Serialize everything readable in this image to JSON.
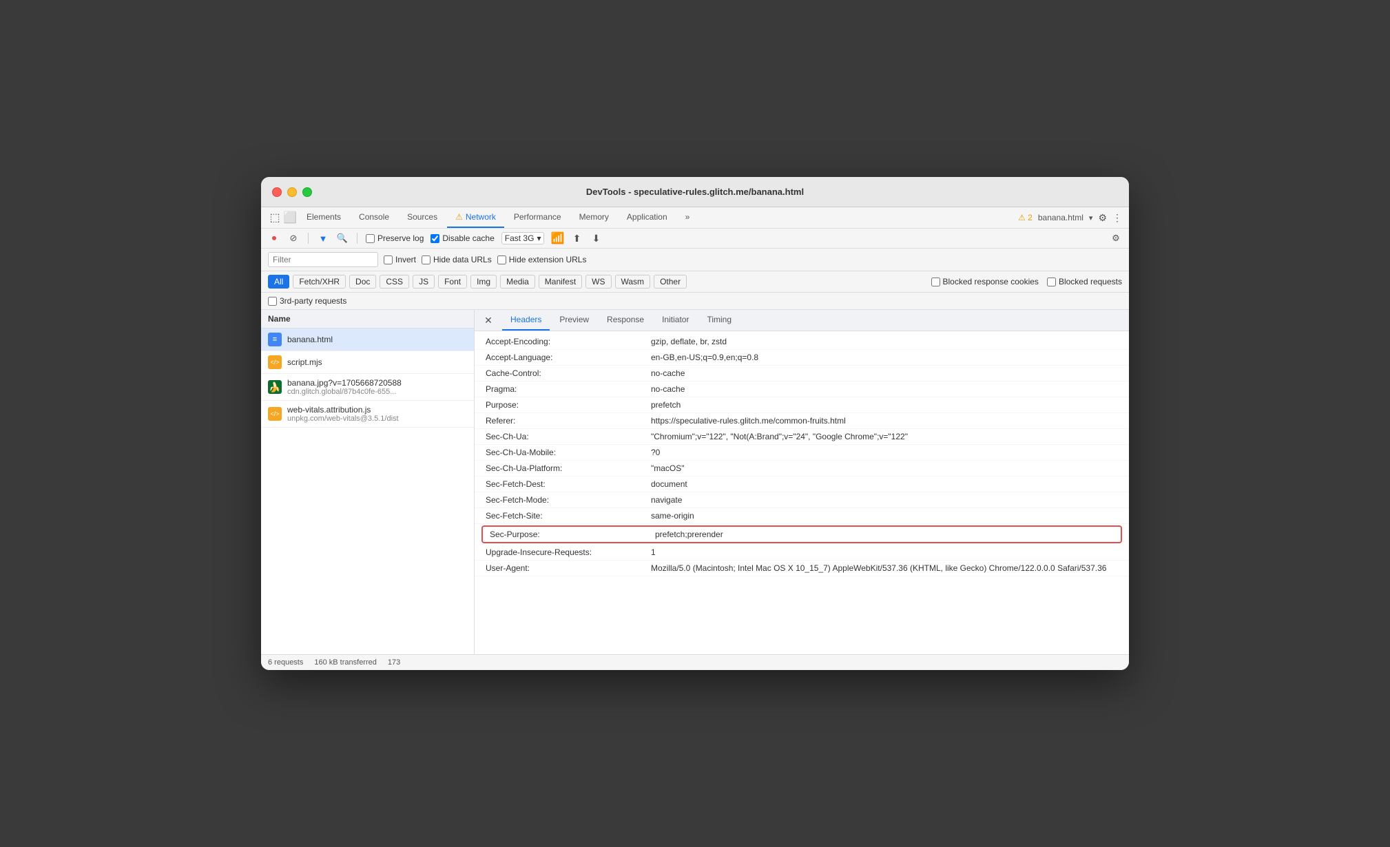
{
  "window": {
    "title": "DevTools - speculative-rules.glitch.me/banana.html"
  },
  "tabs": [
    {
      "label": "Elements",
      "active": false
    },
    {
      "label": "Console",
      "active": false
    },
    {
      "label": "Sources",
      "active": false
    },
    {
      "label": "⚠ Network",
      "active": true
    },
    {
      "label": "Performance",
      "active": false
    },
    {
      "label": "Memory",
      "active": false
    },
    {
      "label": "Application",
      "active": false
    },
    {
      "label": "»",
      "active": false
    }
  ],
  "tab_right": {
    "warning": "⚠ 2",
    "page": "banana.html",
    "settings": "⚙",
    "more": "⋮"
  },
  "controls": {
    "stop": "●",
    "clear": "⊘",
    "filter": "▼",
    "search": "🔍",
    "preserve_log": "Preserve log",
    "disable_cache": "Disable cache",
    "throttle": "Fast 3G",
    "wifi": "📶",
    "upload": "⬆",
    "download": "⬇",
    "settings": "⚙"
  },
  "filter": {
    "placeholder": "Filter",
    "invert": "Invert",
    "hide_data_urls": "Hide data URLs",
    "hide_extension_urls": "Hide extension URLs"
  },
  "type_buttons": [
    {
      "label": "All",
      "active": true
    },
    {
      "label": "Fetch/XHR",
      "active": false
    },
    {
      "label": "Doc",
      "active": false
    },
    {
      "label": "CSS",
      "active": false
    },
    {
      "label": "JS",
      "active": false
    },
    {
      "label": "Font",
      "active": false
    },
    {
      "label": "Img",
      "active": false
    },
    {
      "label": "Media",
      "active": false
    },
    {
      "label": "Manifest",
      "active": false
    },
    {
      "label": "WS",
      "active": false
    },
    {
      "label": "Wasm",
      "active": false
    },
    {
      "label": "Other",
      "active": false
    }
  ],
  "type_bar_right": {
    "blocked_cookies": "Blocked response cookies",
    "blocked_requests": "Blocked requests"
  },
  "third_party": "3rd-party requests",
  "left_panel": {
    "header": "Name",
    "requests": [
      {
        "name": "banana.html",
        "sub": "",
        "icon_type": "html",
        "icon_text": "≡",
        "selected": true
      },
      {
        "name": "script.mjs",
        "sub": "",
        "icon_type": "js",
        "icon_text": "</>",
        "selected": false
      },
      {
        "name": "banana.jpg?v=1705668720588",
        "sub": "cdn.glitch.global/87b4c0fe-655...",
        "icon_type": "img",
        "icon_text": "🍌",
        "selected": false
      },
      {
        "name": "web-vitals.attribution.js",
        "sub": "unpkg.com/web-vitals@3.5.1/dist",
        "icon_type": "js",
        "icon_text": "</>",
        "selected": false
      }
    ]
  },
  "right_panel": {
    "tabs": [
      "Headers",
      "Preview",
      "Response",
      "Initiator",
      "Timing"
    ],
    "active_tab": "Headers",
    "headers": [
      {
        "name": "Accept-Encoding:",
        "value": "gzip, deflate, br, zstd",
        "highlighted": false
      },
      {
        "name": "Accept-Language:",
        "value": "en-GB,en-US;q=0.9,en;q=0.8",
        "highlighted": false
      },
      {
        "name": "Cache-Control:",
        "value": "no-cache",
        "highlighted": false
      },
      {
        "name": "Pragma:",
        "value": "no-cache",
        "highlighted": false
      },
      {
        "name": "Purpose:",
        "value": "prefetch",
        "highlighted": false
      },
      {
        "name": "Referer:",
        "value": "https://speculative-rules.glitch.me/common-fruits.html",
        "highlighted": false
      },
      {
        "name": "Sec-Ch-Ua:",
        "value": "\"Chromium\";v=\"122\", \"Not(A:Brand\";v=\"24\", \"Google Chrome\";v=\"122\"",
        "highlighted": false
      },
      {
        "name": "Sec-Ch-Ua-Mobile:",
        "value": "?0",
        "highlighted": false
      },
      {
        "name": "Sec-Ch-Ua-Platform:",
        "value": "\"macOS\"",
        "highlighted": false
      },
      {
        "name": "Sec-Fetch-Dest:",
        "value": "document",
        "highlighted": false
      },
      {
        "name": "Sec-Fetch-Mode:",
        "value": "navigate",
        "highlighted": false
      },
      {
        "name": "Sec-Fetch-Site:",
        "value": "same-origin",
        "highlighted": false
      },
      {
        "name": "Sec-Purpose:",
        "value": "prefetch;prerender",
        "highlighted": true
      },
      {
        "name": "Upgrade-Insecure-Requests:",
        "value": "1",
        "highlighted": false
      },
      {
        "name": "User-Agent:",
        "value": "Mozilla/5.0 (Macintosh; Intel Mac OS X 10_15_7) AppleWebKit/537.36 (KHTML, like Gecko) Chrome/122.0.0.0 Safari/537.36",
        "highlighted": false
      }
    ]
  },
  "status_bar": {
    "requests": "6 requests",
    "transferred": "160 kB transferred",
    "extra": "173"
  }
}
